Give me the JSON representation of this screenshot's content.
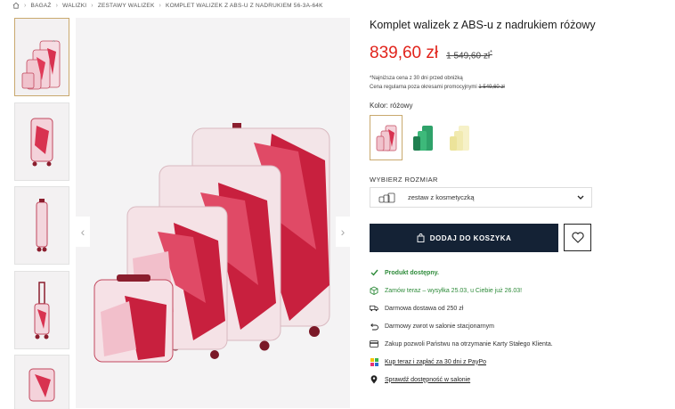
{
  "breadcrumb": {
    "items": [
      "BAGAŻ",
      "WALIZKI",
      "ZESTAWY WALIZEK",
      "KOMPLET WALIZEK Z ABS-U Z NADRUKIEM 56-3A-64K"
    ]
  },
  "product": {
    "title": "Komplet walizek z ABS-u z nadrukiem różowy",
    "price": "839,60 zł",
    "old_price": "1 549,60 zł",
    "old_price_mark": "*",
    "lowest_price_note": "*Najniższa cena z 30 dni przed obniżką",
    "regular_price_label": "Cena regularna poza okresami promocyjnymi",
    "regular_price": "1 549,60 zł"
  },
  "color": {
    "label": "Kolor: różowy",
    "options": [
      "pink",
      "green",
      "yellow"
    ]
  },
  "size": {
    "label": "WYBIERZ ROZMIAR",
    "selected": "zestaw z kosmetyczką"
  },
  "actions": {
    "add_to_cart": "DODAJ DO KOSZYKA"
  },
  "features": [
    {
      "text": "Produkt dostępny.",
      "icon": "check-icon"
    },
    {
      "text": "Zamów teraz – wysyłka 25.03, u Ciebie już 26.03!",
      "icon": "box-icon"
    },
    {
      "text": "Darmowa dostawa od 250 zł",
      "icon": "truck-icon"
    },
    {
      "text": "Darmowy zwrot w salonie stacjonarnym",
      "icon": "return-icon"
    },
    {
      "text": "Zakup pozwoli Państwu na otrzymanie Karty Stałego Klienta.",
      "icon": "card-icon"
    },
    {
      "text": "Kup teraz i zapłać za 30 dni z PayPo",
      "icon": "paypo-icon"
    },
    {
      "text": "Sprawdź dostępność w salonie",
      "icon": "location-pin-icon"
    }
  ],
  "colors": {
    "price": "#e1231b",
    "cart_button": "#142235",
    "available": "#2e8b3a",
    "selected_border": "#c9a96e"
  }
}
